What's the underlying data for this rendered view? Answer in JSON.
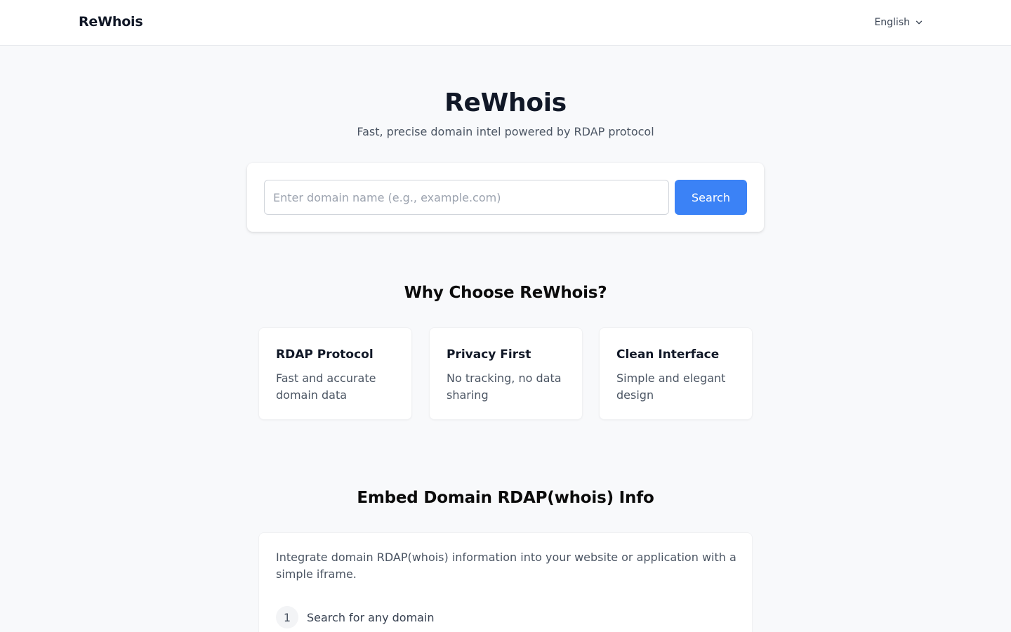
{
  "header": {
    "brand": "ReWhois",
    "language": "English"
  },
  "hero": {
    "title": "ReWhois",
    "subtitle": "Fast, precise domain intel powered by RDAP protocol"
  },
  "search": {
    "placeholder": "Enter domain name (e.g., example.com)",
    "value": "",
    "button_label": "Search",
    "accent_color": "#3b82f6"
  },
  "why": {
    "title": "Why Choose ReWhois?",
    "features": [
      {
        "title": "RDAP Protocol",
        "description": "Fast and accurate domain data"
      },
      {
        "title": "Privacy First",
        "description": "No tracking, no data sharing"
      },
      {
        "title": "Clean Interface",
        "description": "Simple and elegant design"
      }
    ]
  },
  "embed": {
    "title": "Embed Domain RDAP(whois) Info",
    "description": "Integrate domain RDAP(whois) information into your website or application with a simple iframe.",
    "steps": [
      {
        "number": "1",
        "text": "Search for any domain"
      }
    ]
  },
  "icons": {
    "language_dropdown": "chevron-down-icon"
  }
}
